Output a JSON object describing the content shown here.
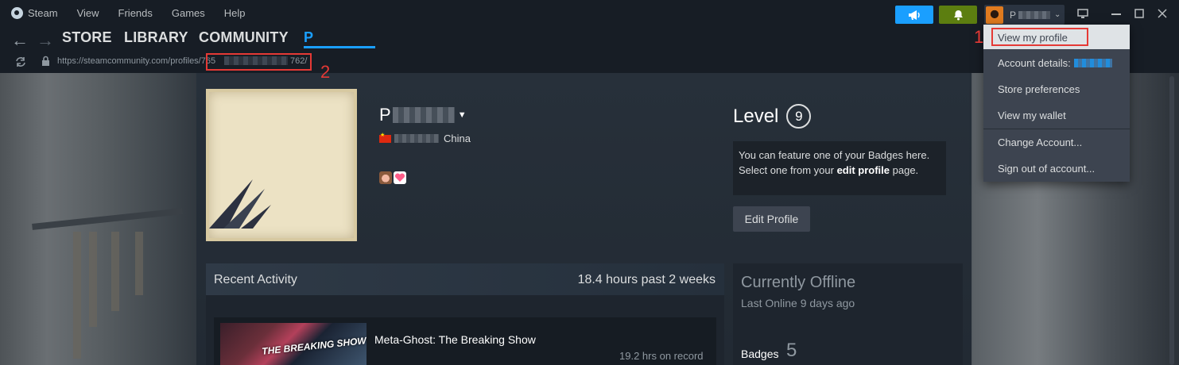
{
  "menu": {
    "app": "Steam",
    "items": [
      "View",
      "Friends",
      "Games",
      "Help"
    ]
  },
  "titlebar": {
    "announce_icon": "megaphone-icon",
    "notify_icon": "bell-icon",
    "account_name_prefix": "P",
    "account_chevron": "⌄",
    "window_icons": [
      "monitor-icon",
      "minimize-icon",
      "maximize-icon",
      "close-icon"
    ]
  },
  "nav": {
    "back": "←",
    "forward": "→",
    "tabs": [
      "STORE",
      "LIBRARY",
      "COMMUNITY",
      "P"
    ]
  },
  "url": {
    "prefix": "https://steamcommunity.com/profiles/",
    "id_start": "765",
    "id_end": "762/"
  },
  "annotations": {
    "one": "1",
    "two": "2"
  },
  "profile": {
    "name_prefix": "P",
    "location": "China",
    "level_label": "Level",
    "level": "9",
    "badge_text_1": "You can feature one of your Badges here.",
    "badge_text_2a": "Select one from your ",
    "badge_text_2b": "edit profile",
    "badge_text_2c": " page.",
    "edit_button": "Edit Profile"
  },
  "activity": {
    "title": "Recent Activity",
    "summary": "18.4 hours past 2 weeks",
    "game_name": "Meta-Ghost: The Breaking Show",
    "game_hours": "19.2 hrs on record",
    "thumb_text": "THE BREAKING SHOW"
  },
  "status": {
    "title": "Currently Offline",
    "sub": "Last Online 9 days ago",
    "badges_label": "Badges",
    "badges_count": "5"
  },
  "dropdown": {
    "view_profile": "View my profile",
    "account_details": "Account details:",
    "store_prefs": "Store preferences",
    "wallet": "View my wallet",
    "change_account": "Change Account...",
    "sign_out": "Sign out of account..."
  },
  "colors": {
    "accent": "#1a9fff",
    "notify": "#5c7e10",
    "annotation": "#e53935"
  }
}
